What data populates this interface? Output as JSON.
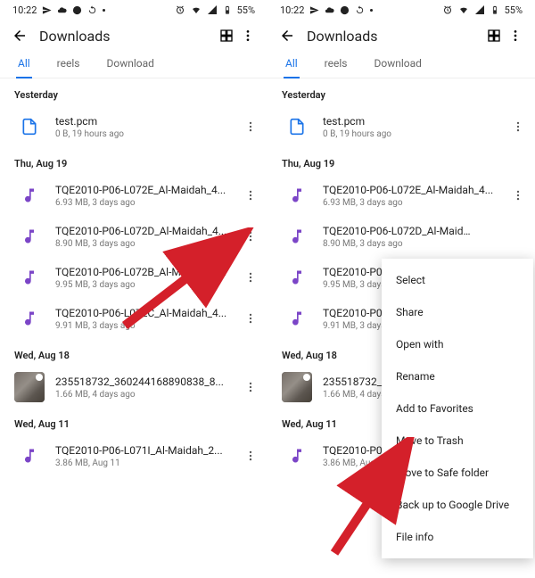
{
  "status": {
    "time": "10:22",
    "battery": "55%"
  },
  "header": {
    "title": "Downloads"
  },
  "tabs": {
    "all": "All",
    "reels": "reels",
    "download": "Download"
  },
  "menu": {
    "select": "Select",
    "share": "Share",
    "open_with": "Open with",
    "rename": "Rename",
    "add_fav": "Add to Favorites",
    "trash": "Move to Trash",
    "safe": "Move to Safe folder",
    "backup": "Back up to Google Drive",
    "info": "File info"
  },
  "sections": {
    "s0": "Yesterday",
    "s1": "Thu, Aug 19",
    "s2": "Wed, Aug 18",
    "s3": "Wed, Aug 11"
  },
  "files": {
    "f0": {
      "name": "test.pcm",
      "stat": "0 B, 19 hours ago"
    },
    "f1": {
      "name": "TQE2010-P06-L072E_Al-Maidah_4...",
      "stat": "6.93 MB, 3 days ago"
    },
    "f2": {
      "name": "TQE2010-P06-L072D_Al-Maidah_4...",
      "stat": "8.90 MB, 3 days ago"
    },
    "f3": {
      "name": "TQE2010-P06-L072B_Al-Maidah_4...",
      "stat": "9.95 MB, 3 days ago"
    },
    "f4": {
      "name": "TQE2010-P06-L072C_Al-Maidah_4...",
      "stat": "9.91 MB, 3 days ago"
    },
    "f5": {
      "name": "235518732_360244168890838_8...",
      "stat": "1.66 MB, 4 days ago"
    },
    "f6": {
      "name": "TQE2010-P06-L071I_Al-Maidah_2...",
      "stat": "3.86 MB, Aug 11"
    },
    "r2": {
      "name": "TQE2010-P06-L072D_Al-Maid…",
      "stat": "8.90 MB, 3 days ago"
    },
    "r3": {
      "name": "TQE2010-P06-L",
      "stat": "9.95 MB, 3 days ago"
    },
    "r4": {
      "name": "TQE2010-P06-L",
      "stat": "9.91 MB, 3 days ago"
    },
    "r6": {
      "name": "TQE2010-P06-L",
      "stat": "3.86 MB, Aug 11"
    }
  }
}
